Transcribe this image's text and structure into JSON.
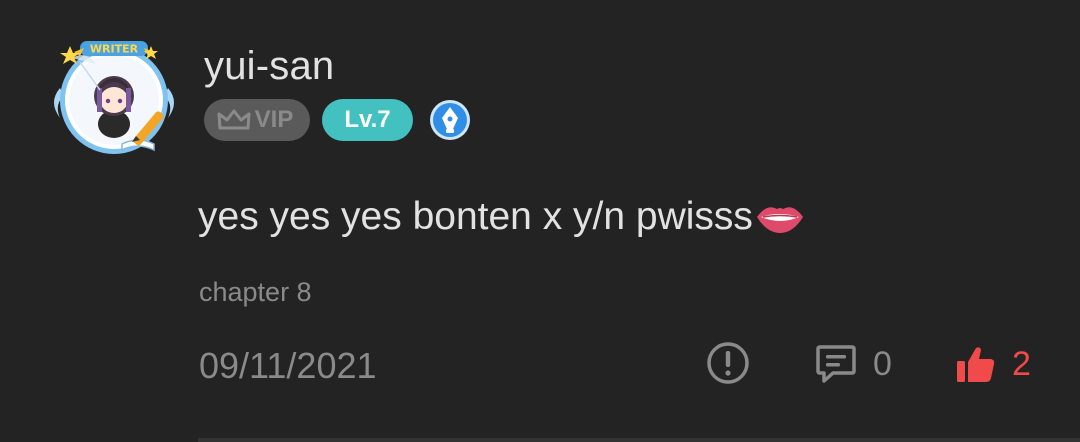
{
  "comment": {
    "username": "yui-san",
    "avatar_frame_label": "WRITER",
    "vip_label": "VIP",
    "level_label": "Lv.7",
    "text": "yes yes yes bonten x y/n pwisss",
    "emoji_icon": "lips-emoji",
    "chapter": "chapter 8",
    "date": "09/11/2021",
    "reply_count": "0",
    "like_count": "2"
  },
  "colors": {
    "background": "#232323",
    "primary_text": "#e2e2e2",
    "secondary_text": "#8a8a8a",
    "level_badge": "#43c0c0",
    "vip_badge": "#5a5a5a",
    "like_red": "#f04a4a",
    "writer_badge_blue": "#2f8fe6"
  },
  "icons": {
    "vip": "crown-icon",
    "writer": "pen-nib-icon",
    "report": "exclamation-circle-icon",
    "reply": "comment-bubble-icon",
    "like": "thumbs-up-icon"
  }
}
